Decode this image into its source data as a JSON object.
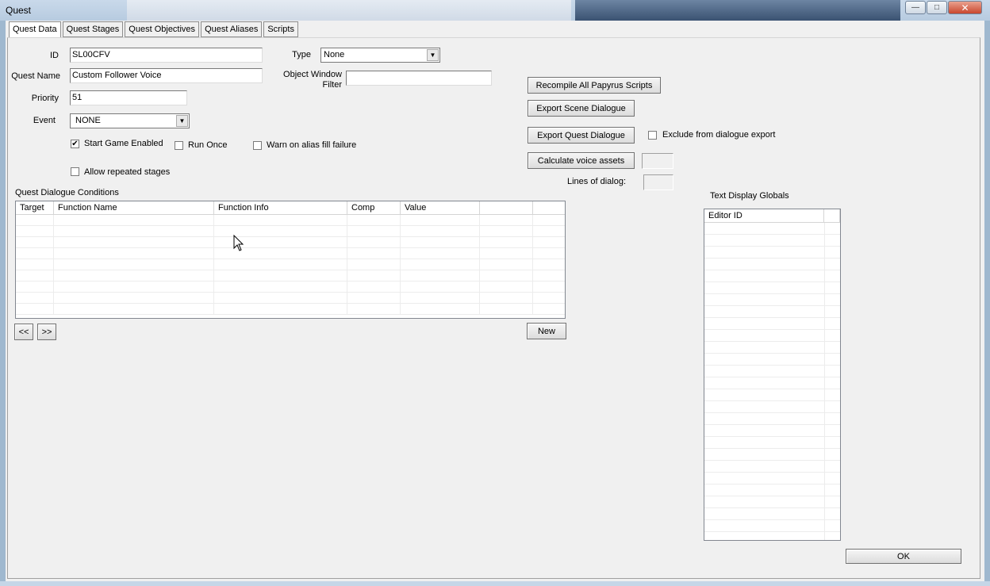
{
  "window": {
    "title": "Quest"
  },
  "tabs": [
    "Quest Data",
    "Quest Stages",
    "Quest Objectives",
    "Quest Aliases",
    "Scripts"
  ],
  "form": {
    "id_label": "ID",
    "id_value": "SL00CFV",
    "quest_name_label": "Quest Name",
    "quest_name_value": "Custom Follower Voice",
    "priority_label": "Priority",
    "priority_value": "51",
    "event_label": "Event",
    "event_value": "NONE",
    "type_label": "Type",
    "type_value": "None",
    "object_window_filter_label": "Object Window Filter",
    "object_window_filter_value": ""
  },
  "checkboxes": {
    "start_game_enabled": {
      "label": "Start Game Enabled",
      "checked": true
    },
    "run_once": {
      "label": "Run Once",
      "checked": false
    },
    "warn_alias": {
      "label": "Warn on alias fill failure",
      "checked": false
    },
    "allow_repeated": {
      "label": "Allow repeated stages",
      "checked": false
    },
    "exclude_dialogue": {
      "label": "Exclude from dialogue export",
      "checked": false
    }
  },
  "buttons": {
    "recompile": "Recompile All Papyrus Scripts",
    "export_scene": "Export Scene Dialogue",
    "export_quest": "Export Quest Dialogue",
    "calc_voice": "Calculate voice assets",
    "prev": "<<",
    "next": ">>",
    "new": "New",
    "ok": "OK"
  },
  "lines_of_dialog_label": "Lines of dialog:",
  "conditions": {
    "title": "Quest Dialogue Conditions",
    "columns": [
      "Target",
      "Function Name",
      "Function Info",
      "Comp",
      "Value",
      ""
    ]
  },
  "globals": {
    "title": "Text Display Globals",
    "columns": [
      "Editor ID",
      ""
    ]
  }
}
